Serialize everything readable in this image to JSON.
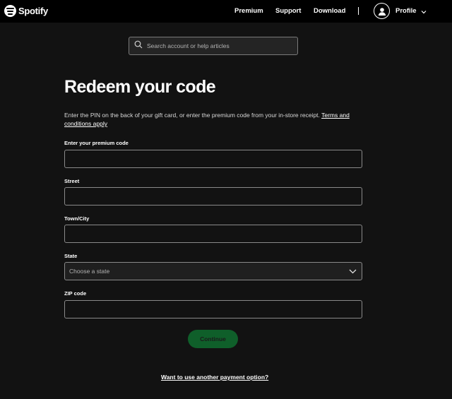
{
  "header": {
    "brand": "Spotify",
    "nav": {
      "premium": "Premium",
      "support": "Support",
      "download": "Download"
    },
    "profile_label": "Profile"
  },
  "search": {
    "placeholder": "Search account or help articles"
  },
  "main": {
    "title": "Redeem your code",
    "description": "Enter the PIN on the back of your gift card, or enter the premium code from your in-store receipt.",
    "terms_link": "Terms and conditions apply",
    "fields": {
      "premium_code": {
        "label": "Enter your premium code",
        "value": ""
      },
      "street": {
        "label": "Street",
        "value": ""
      },
      "town": {
        "label": "Town/City",
        "value": ""
      },
      "state": {
        "label": "State",
        "selected": "Choose a state"
      },
      "zip": {
        "label": "ZIP code",
        "value": ""
      }
    },
    "continue_label": "Continue",
    "other_payment_link": "Want to use another payment option?"
  },
  "colors": {
    "background": "#121212",
    "header": "#000000",
    "accent_dim": "#0f5f2a"
  }
}
